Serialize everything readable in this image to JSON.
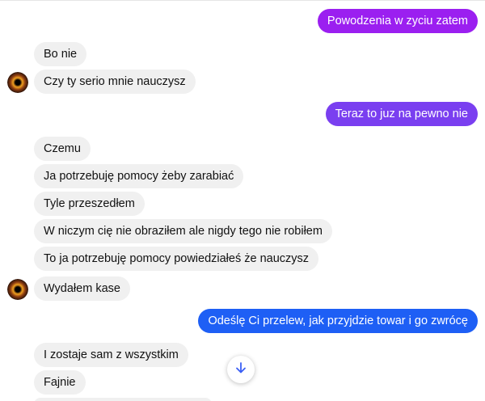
{
  "messages": [
    {
      "text": "Powodzenia w zyciu zatem",
      "direction": "out",
      "color": "#9b1ff0"
    },
    {
      "text": "Bo nie",
      "direction": "in"
    },
    {
      "text": "Czy ty serio mnie nauczysz",
      "direction": "in",
      "avatar": true
    },
    {
      "text": "Teraz to juz na pewno nie",
      "direction": "out",
      "color": "#7a3ff0"
    },
    {
      "text": "Czemu",
      "direction": "in"
    },
    {
      "text": "Ja potrzebuję pomocy żeby zarabiać",
      "direction": "in"
    },
    {
      "text": "Tyle przeszedłem",
      "direction": "in"
    },
    {
      "text": "W niczym cię nie obraziłem ale nigdy tego nie robiłem",
      "direction": "in"
    },
    {
      "text": "To ja potrzebuję pomocy powiedziałeś że nauczysz",
      "direction": "in"
    },
    {
      "text": "Wydałem kase",
      "direction": "in",
      "avatar": true
    },
    {
      "text": "Odeślę Ci przelew, jak przyjdzie towar i go zwrócę",
      "direction": "out",
      "color": "#1e5ff5"
    },
    {
      "text": "I zostaje sam z wszystkim",
      "direction": "in"
    },
    {
      "text": "Fajnie",
      "direction": "in"
    }
  ],
  "icons": {
    "avatar": "contact-avatar",
    "scroll": "arrow-down-icon"
  }
}
